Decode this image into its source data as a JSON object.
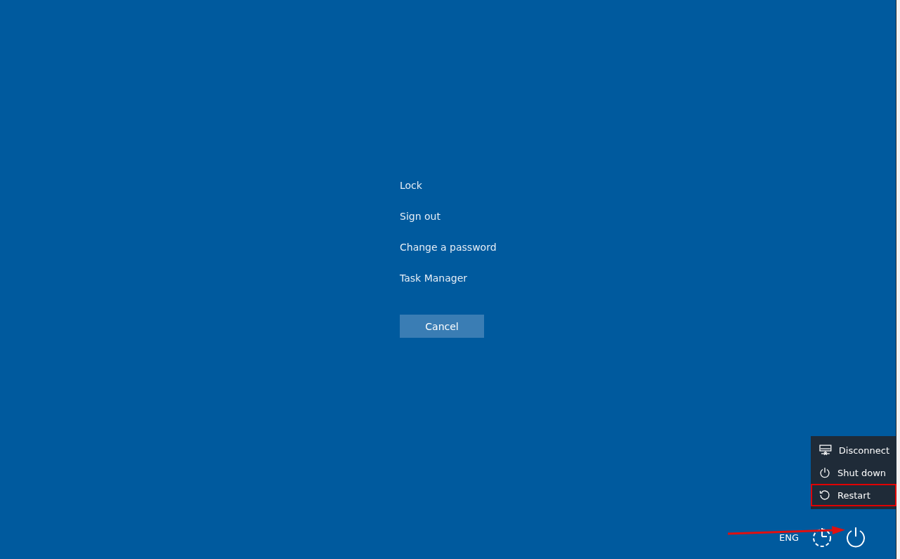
{
  "options": [
    {
      "label": "Lock"
    },
    {
      "label": "Sign out"
    },
    {
      "label": "Change a password"
    },
    {
      "label": "Task Manager"
    }
  ],
  "cancel_button": {
    "label": "Cancel"
  },
  "power_menu": {
    "items": [
      {
        "kind": "disconnect",
        "label": "Disconnect",
        "highlighted": false
      },
      {
        "kind": "shutdown",
        "label": "Shut down",
        "highlighted": false
      },
      {
        "kind": "restart",
        "label": "Restart",
        "highlighted": true
      }
    ]
  },
  "bottom_bar": {
    "language": "ENG"
  }
}
